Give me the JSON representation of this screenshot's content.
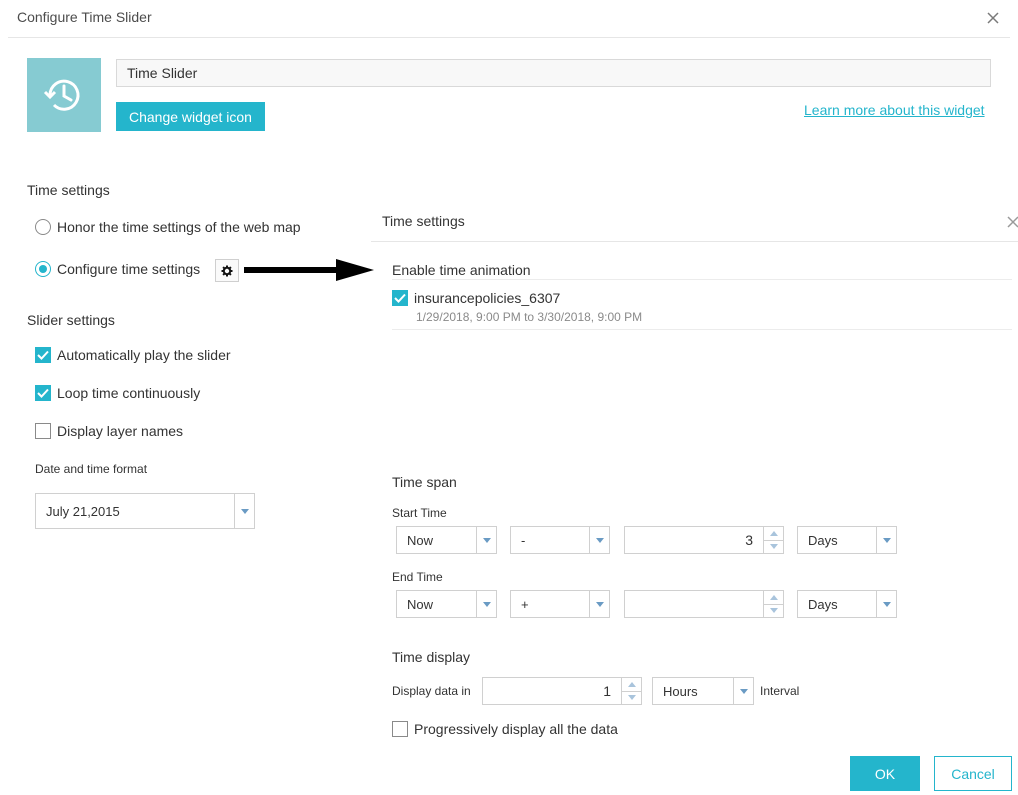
{
  "dialog": {
    "title": "Configure Time Slider"
  },
  "widget": {
    "name_value": "Time Slider",
    "change_icon_label": "Change widget icon",
    "learn_more_label": "Learn more about this widget",
    "icon": "clock-history-icon"
  },
  "time_settings": {
    "heading": "Time settings",
    "options": [
      {
        "label": "Honor the time settings of the web map",
        "selected": false
      },
      {
        "label": "Configure time settings",
        "selected": true
      }
    ]
  },
  "slider_settings": {
    "heading": "Slider settings",
    "checkboxes": [
      {
        "label": "Automatically play the slider",
        "checked": true
      },
      {
        "label": "Loop time continuously",
        "checked": true
      },
      {
        "label": "Display layer names",
        "checked": false
      }
    ],
    "format_label": "Date and time format",
    "format_value": "July 21,2015"
  },
  "panel": {
    "title": "Time settings",
    "enable_heading": "Enable time animation",
    "layer": {
      "name": "insurancepolicies_6307",
      "range": "1/29/2018, 9:00 PM to 3/30/2018, 9:00 PM",
      "checked": true
    },
    "time_span": {
      "heading": "Time span",
      "start_label": "Start Time",
      "start": {
        "base": "Now",
        "operator": "-",
        "amount": "3",
        "unit": "Days"
      },
      "end_label": "End Time",
      "end": {
        "base": "Now",
        "operator": "+",
        "amount": "",
        "unit": "Days"
      }
    },
    "time_display": {
      "heading": "Time display",
      "display_label": "Display data in",
      "amount": "1",
      "unit": "Hours",
      "suffix": "Interval",
      "progressive_label": "Progressively display all the data",
      "progressive_checked": false
    }
  },
  "footer": {
    "ok_label": "OK",
    "cancel_label": "Cancel"
  },
  "colors": {
    "accent": "#24b5cc",
    "icon_tile": "#86cbd2"
  }
}
